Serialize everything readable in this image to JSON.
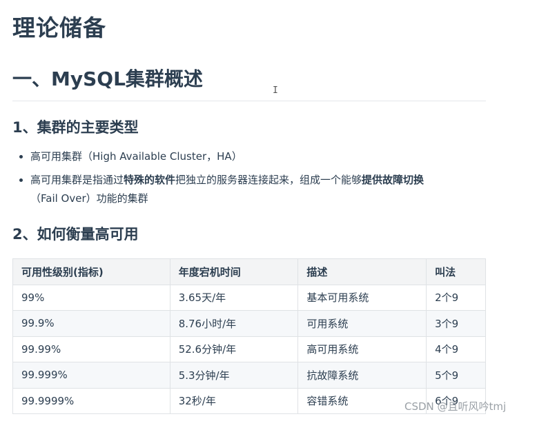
{
  "title": "理论储备",
  "section": "一、MySQL集群概述",
  "sub1": "1、集群的主要类型",
  "bullets": {
    "b1": "高可用集群（High Available Cluster，HA）",
    "b2_pre": "高可用集群是指通过",
    "b2_bold1": "特殊的软件",
    "b2_mid": "把独立的服务器连接起来，组成一个能够",
    "b2_bold2": "提供故障切换",
    "b2_post": "（Fail Over）功能的集群"
  },
  "sub2": "2、如何衡量高可用",
  "table": {
    "headers": [
      "可用性级别(指标)",
      "年度宕机时间",
      "描述",
      "叫法"
    ],
    "rows": [
      [
        "99%",
        "3.65天/年",
        "基本可用系统",
        "2个9"
      ],
      [
        "99.9%",
        "8.76小时/年",
        "可用系统",
        "3个9"
      ],
      [
        "99.99%",
        "52.6分钟/年",
        "高可用系统",
        "4个9"
      ],
      [
        "99.999%",
        "5.3分钟/年",
        "抗故障系统",
        "5个9"
      ],
      [
        "99.9999%",
        "32秒/年",
        "容错系统",
        "6个9"
      ]
    ]
  },
  "watermark": "CSDN @且听风吟tmj",
  "cursor_glyph": "I"
}
